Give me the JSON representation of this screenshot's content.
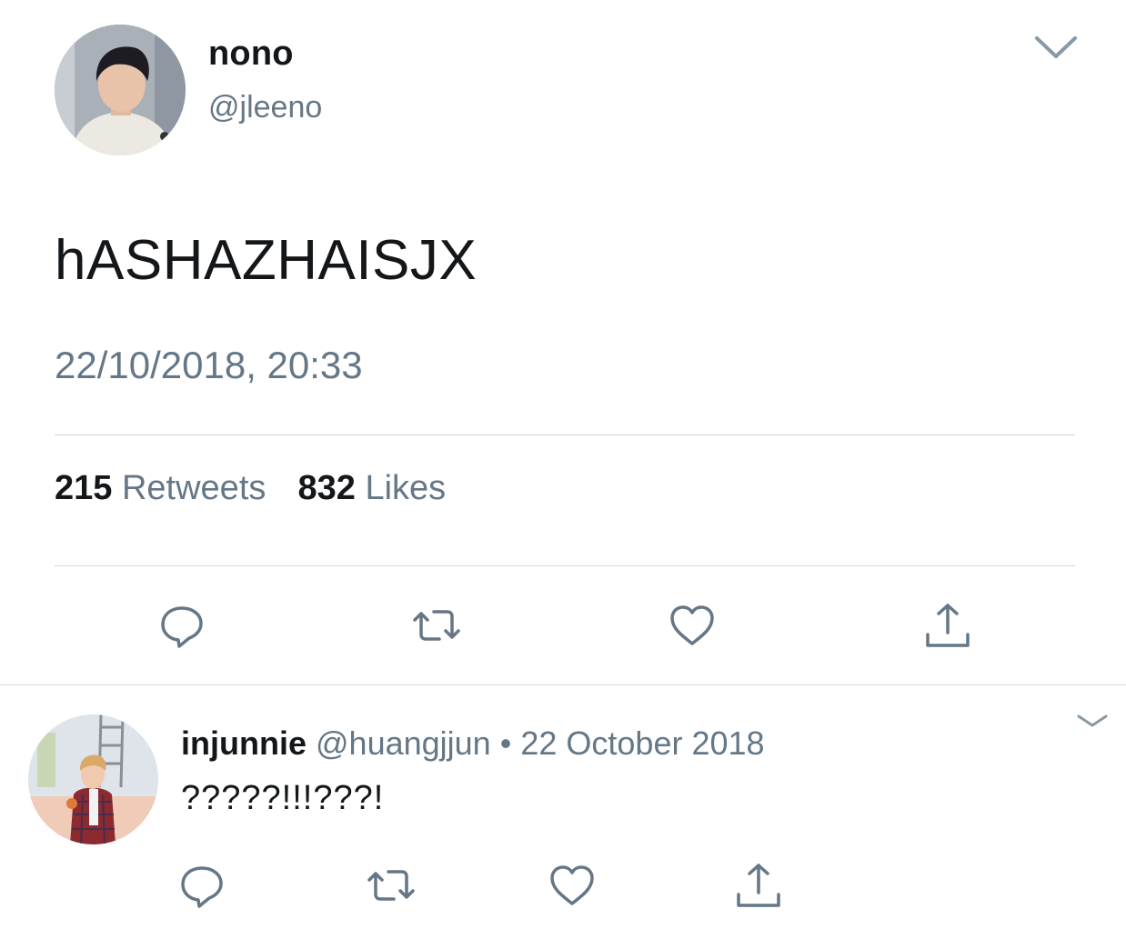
{
  "main_tweet": {
    "display_name": "nono",
    "handle": "@jleeno",
    "text": "hASHAZHAISJX",
    "timestamp": "22/10/2018, 20:33",
    "stats": {
      "retweets_count": "215",
      "retweets_label": "Retweets",
      "likes_count": "832",
      "likes_label": "Likes"
    },
    "actions": [
      "reply-icon",
      "retweet-icon",
      "like-icon",
      "share-icon"
    ]
  },
  "reply_tweet": {
    "display_name": "injunnie",
    "handle": "@huangjjun",
    "separator": "•",
    "date": "22 October 2018",
    "text": "?????!!!???!",
    "actions": [
      "reply-icon",
      "retweet-icon",
      "like-icon",
      "share-icon"
    ]
  },
  "colors": {
    "text_primary": "#14171a",
    "text_secondary": "#657786",
    "icon": "#657786",
    "divider": "#cfd6dc"
  }
}
